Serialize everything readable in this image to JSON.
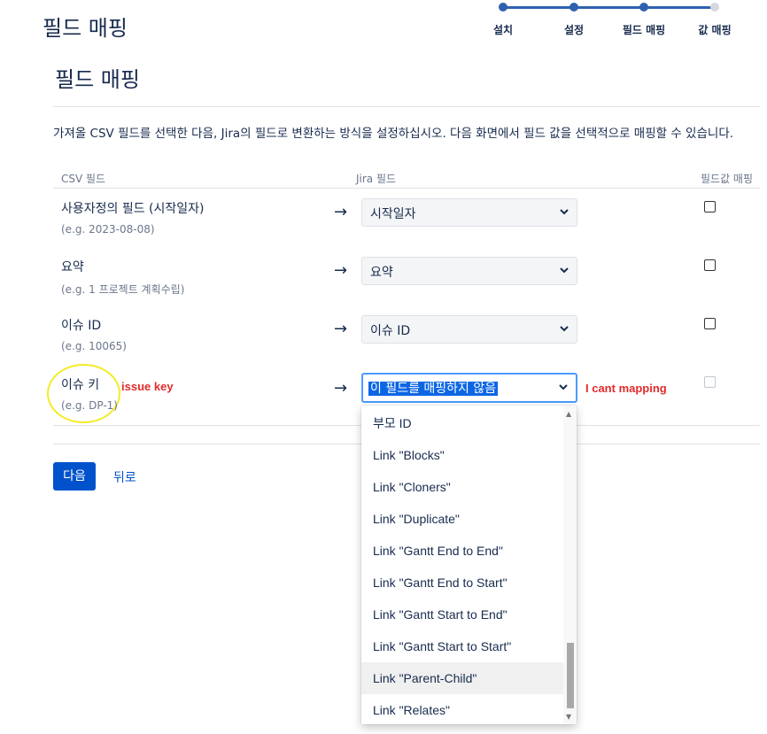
{
  "header": {
    "title": "필드 매핑"
  },
  "stepper": {
    "steps": [
      {
        "label": "설치",
        "done": true
      },
      {
        "label": "설정",
        "done": true
      },
      {
        "label": "필드 매핑",
        "done": true
      },
      {
        "label": "값 매핑",
        "done": false
      }
    ]
  },
  "main": {
    "title": "필드 매핑",
    "description": "가져올 CSV 필드를 선택한 다음, Jira의 필드로 변환하는 방식을 설정하십시오. 다음 화면에서 필드 값을 선택적으로 매핑할 수 있습니다.",
    "columns": {
      "csv": "CSV 필드",
      "jira": "Jira 필드",
      "value_map": "필드값 매핑"
    },
    "rows": [
      {
        "name": "사용자정의 필드 (시작일자)",
        "example": "(e.g. 2023-08-08)",
        "mapping": "시작일자"
      },
      {
        "name": "요약",
        "example": "(e.g. 1 프로젝트 계획수립)",
        "mapping": "요약"
      },
      {
        "name": "이슈 ID",
        "example": "(e.g. 10065)",
        "mapping": "이슈 ID"
      },
      {
        "name": "이슈 키",
        "example": "(e.g. DP-1)",
        "mapping": "이 필드를 매핑하지 않음"
      }
    ],
    "arrow": "→"
  },
  "annotations": {
    "issue_key": "issue key",
    "cant_mapping": "I cant mapping"
  },
  "footer": {
    "next_label": "다음",
    "back_label": "뒤로"
  },
  "dropdown": {
    "options": [
      "부모 ID",
      "Link \"Blocks\"",
      "Link \"Cloners\"",
      "Link \"Duplicate\"",
      "Link \"Gantt End to End\"",
      "Link \"Gantt End to Start\"",
      "Link \"Gantt Start to End\"",
      "Link \"Gantt Start to Start\"",
      "Link \"Parent-Child\"",
      "Link \"Relates\""
    ],
    "hovered_option": "Link \"Parent-Child\""
  },
  "colors": {
    "primary": "#0052cc",
    "stepper": "#2e62b0",
    "annotation": "#e22b2b",
    "highlight": "#f3ec2a"
  }
}
